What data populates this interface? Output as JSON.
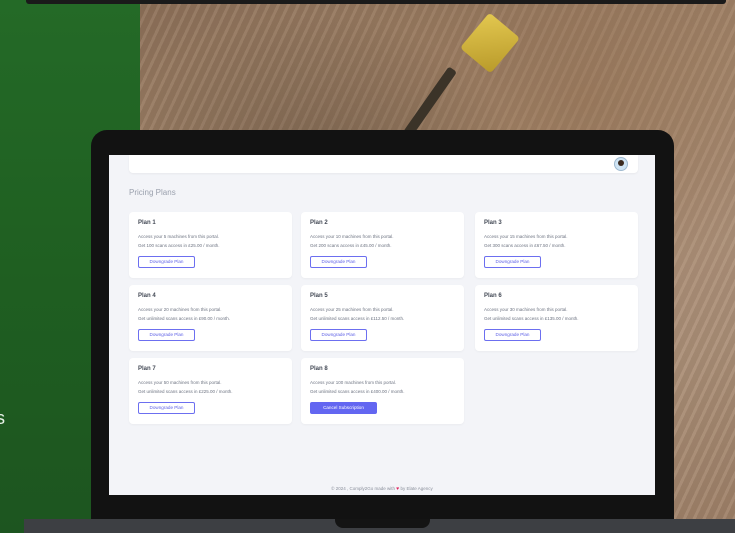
{
  "page_title": "Pricing Plans",
  "plans": [
    {
      "name": "Plan 1",
      "line1": "Access your 5 machines from this portal.",
      "line2": "Get 100 scans access in £25.00 / month.",
      "button": "Downgrade Plan"
    },
    {
      "name": "Plan 2",
      "line1": "Access your 10 machines from this portal.",
      "line2": "Get 200 scans access in £45.00 / month.",
      "button": "Downgrade Plan"
    },
    {
      "name": "Plan 3",
      "line1": "Access your 15 machines from this portal.",
      "line2": "Get 300 scans access in £67.50 / month.",
      "button": "Downgrade Plan"
    },
    {
      "name": "Plan 4",
      "line1": "Access your 20 machines from this portal.",
      "line2": "Get unlimited scans access in £90.00 / month.",
      "button": "Downgrade Plan"
    },
    {
      "name": "Plan 5",
      "line1": "Access your 25 machines from this portal.",
      "line2": "Get unlimited scans access in £112.50 / month.",
      "button": "Downgrade Plan"
    },
    {
      "name": "Plan 6",
      "line1": "Access your 30 machines from this portal.",
      "line2": "Get unlimited scans access in £135.00 / month.",
      "button": "Downgrade Plan"
    },
    {
      "name": "Plan 7",
      "line1": "Access your 50 machines from this portal.",
      "line2": "Get unlimited scans access in £225.00 / month.",
      "button": "Downgrade Plan"
    },
    {
      "name": "Plan 8",
      "line1": "Access your 100 machines from this portal.",
      "line2": "Get unlimited scans access in £400.00 / month.",
      "button": "Cancel Subscription"
    }
  ],
  "footer": {
    "prefix": "© 2024 , Comply2Go made with",
    "suffix": "by Elate Agency"
  },
  "edge_letter": "s",
  "colors": {
    "accent": "#6366f1",
    "background_green": "#246a27",
    "screen_bg": "#f3f4f8"
  },
  "icons": {
    "avatar": "user-avatar-icon",
    "heart": "heart-icon"
  }
}
